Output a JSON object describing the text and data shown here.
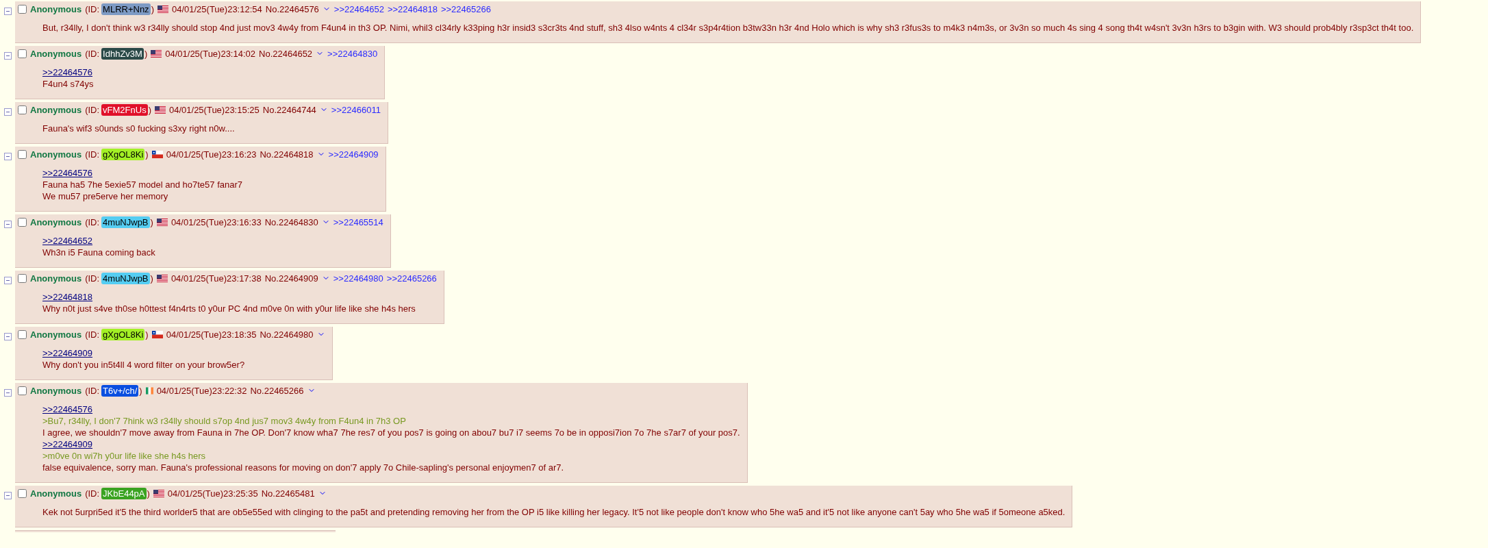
{
  "posts": [
    {
      "checked": false,
      "name": "Anonymous",
      "id_open": "(ID:",
      "id": {
        "text": "MLRR+Nnz",
        "color": "#7d9ac4"
      },
      "id_close": ")",
      "flag": {
        "kind": "us"
      },
      "datetime": "04/01/25(Tue)23:12:54",
      "number": "No.22464576",
      "backlinks": [
        ">>22464652",
        ">>22464818",
        ">>22465266"
      ],
      "body": [
        {
          "kind": "text",
          "text": "But, r34lly, I don't think w3 r34lly should stop 4nd just mov3 4w4y from F4un4 in th3 OP. Nimi, whil3 cl34rly k33ping h3r insid3 s3cr3ts 4nd stuff, sh3 4lso w4nts 4 cl34r s3p4r4tion b3tw33n h3r 4nd Holo which is why sh3 r3fus3s to m4k3 n4m3s, or 3v3n so much 4s sing 4 song th4t w4sn't 3v3n h3rs to b3gin with. W3 should prob4bly r3sp3ct th4t too."
        }
      ]
    },
    {
      "checked": false,
      "name": "Anonymous",
      "id_open": "(ID:",
      "id": {
        "text": "IdhhZv3M",
        "color": "#2b4a48"
      },
      "id_close": ")",
      "flag": {
        "kind": "us"
      },
      "datetime": "04/01/25(Tue)23:14:02",
      "number": "No.22464652",
      "backlinks": [
        ">>22464830"
      ],
      "body": [
        {
          "kind": "quotelink",
          "text": ">>22464576"
        },
        {
          "kind": "text",
          "text": "F4un4 s74ys"
        }
      ]
    },
    {
      "checked": false,
      "name": "Anonymous",
      "id_open": "(ID:",
      "id": {
        "text": "vFM2FnUs",
        "color": "#e0102a"
      },
      "id_close": ")",
      "flag": {
        "kind": "us"
      },
      "datetime": "04/01/25(Tue)23:15:25",
      "number": "No.22464744",
      "backlinks": [
        ">>22466011"
      ],
      "body": [
        {
          "kind": "text",
          "text": "Fauna's wif3 s0unds s0 fucking s3xy right n0w...."
        }
      ]
    },
    {
      "checked": false,
      "name": "Anonymous",
      "id_open": "(ID:",
      "id": {
        "text": "gXgOL8Ki",
        "color": "#a3f025"
      },
      "id_close": ")",
      "flag": {
        "kind": "cl"
      },
      "datetime": "04/01/25(Tue)23:16:23",
      "number": "No.22464818",
      "backlinks": [
        ">>22464909"
      ],
      "body": [
        {
          "kind": "quotelink",
          "text": ">>22464576"
        },
        {
          "kind": "text",
          "text": "Fauna ha5 7he 5exie57 model and ho7te57 fanar7"
        },
        {
          "kind": "text",
          "text": "We mu57 pre5erve her memory"
        }
      ]
    },
    {
      "checked": false,
      "name": "Anonymous",
      "id_open": "(ID:",
      "id": {
        "text": "4muNJwpB",
        "color": "#55cdf2"
      },
      "id_close": ")",
      "flag": {
        "kind": "us"
      },
      "datetime": "04/01/25(Tue)23:16:33",
      "number": "No.22464830",
      "backlinks": [
        ">>22465514"
      ],
      "body": [
        {
          "kind": "quotelink",
          "text": ">>22464652"
        },
        {
          "kind": "text",
          "text": "Wh3n i5 Fauna coming back"
        }
      ]
    },
    {
      "checked": false,
      "name": "Anonymous",
      "id_open": "(ID:",
      "id": {
        "text": "4muNJwpB",
        "color": "#55cdf2"
      },
      "id_close": ")",
      "flag": {
        "kind": "us"
      },
      "datetime": "04/01/25(Tue)23:17:38",
      "number": "No.22464909",
      "backlinks": [
        ">>22464980",
        ">>22465266"
      ],
      "body": [
        {
          "kind": "quotelink",
          "text": ">>22464818"
        },
        {
          "kind": "text",
          "text": "Why n0t just s4ve th0se h0ttest f4n4rts t0 y0ur PC 4nd m0ve 0n with y0ur life like she h4s hers"
        }
      ]
    },
    {
      "checked": false,
      "name": "Anonymous",
      "id_open": "(ID:",
      "id": {
        "text": "gXgOL8Ki",
        "color": "#a3f025"
      },
      "id_close": ")",
      "flag": {
        "kind": "cl"
      },
      "datetime": "04/01/25(Tue)23:18:35",
      "number": "No.22464980",
      "body": [
        {
          "kind": "quotelink",
          "text": ">>22464909"
        },
        {
          "kind": "text",
          "text": "Why don't you in5t4ll 4 word filter on your brow5er?"
        }
      ]
    },
    {
      "checked": false,
      "name": "Anonymous",
      "id_open": "(ID:",
      "id": {
        "text": "T6v+/ch/",
        "color": "#0a4fe0"
      },
      "id_close": ")",
      "flag": {
        "kind": "ie"
      },
      "datetime": "04/01/25(Tue)23:22:32",
      "number": "No.22465266",
      "body": [
        {
          "kind": "quotelink",
          "text": ">>22464576"
        },
        {
          "kind": "greentext",
          "text": ">Bu7, r34lly, I don'7 7hink w3 r34lly should s7op 4nd jus7 mov3 4w4y from F4un4 in 7h3 OP"
        },
        {
          "kind": "text",
          "text": "I agree, we shouldn'7 move away from Fauna in 7he OP. Don'7 know wha7 7he res7 of you pos7 is going on abou7 bu7 i7 seems 7o be in opposi7ion 7o 7he s7ar7 of your pos7."
        },
        {
          "kind": "quotelink",
          "text": ">>22464909"
        },
        {
          "kind": "greentext",
          "text": ">m0ve 0n wi7h y0ur life like she h4s hers"
        },
        {
          "kind": "text",
          "text": "false equivalence, sorry man. Fauna's professional reasons for moving on don'7 apply 7o Chile-sapling's personal enjoymen7 of ar7."
        }
      ]
    },
    {
      "checked": false,
      "name": "Anonymous",
      "id_open": "(ID:",
      "id": {
        "text": "JKbE44pA",
        "color": "#3aa321"
      },
      "id_close": ")",
      "flag": {
        "kind": "us"
      },
      "datetime": "04/01/25(Tue)23:25:35",
      "number": "No.22465481",
      "body": [
        {
          "kind": "text",
          "text": "Kek not 5urpri5ed it'5 the third worlder5 that are ob5e55ed with clinging to the pa5t and pretending removing her from the OP i5 like killing her legacy. It'5 not like people don't know who 5he wa5 and it'5 not like anyone can't 5ay who 5he wa5 if 5omeone a5ked."
        }
      ]
    }
  ]
}
